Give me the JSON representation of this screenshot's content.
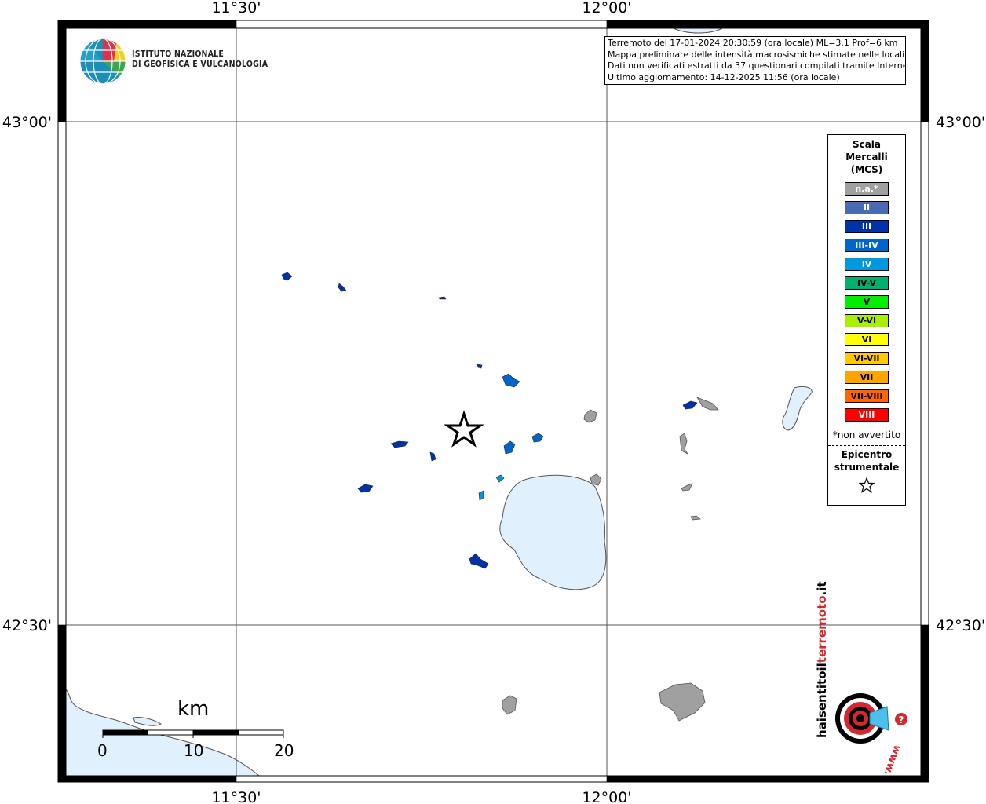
{
  "map": {
    "longitude_labels": [
      "11°30'",
      "12°00'"
    ],
    "latitude_labels": [
      "43°00'",
      "42°30'"
    ],
    "colors": {
      "water": "#e0f0fc",
      "na": "#a0a0a0",
      "III": "#0033aa",
      "III-IV": "#0066cc",
      "IV": "#0099dd"
    }
  },
  "header": {
    "logo_line1": "ISTITUTO NAZIONALE",
    "logo_line2": "DI GEOFISICA E VULCANOLOGIA"
  },
  "info": {
    "line1": "Terremoto del 17-01-2024 20:30:59 (ora locale) ML=3.1 Prof=6 km",
    "line2": "Mappa preliminare delle intensità macrosismiche stimate nelle località",
    "line3": "Dati non verificati estratti da 37 questionari compilati tramite Internet.",
    "line4": "Ultimo aggiornamento: 14-12-2025 11:56 (ora locale)"
  },
  "legend": {
    "title_line1": "Scala",
    "title_line2": "Mercalli",
    "title_line3": "(MCS)",
    "items": [
      {
        "label": "n.a.*",
        "color": "#a0a0a0",
        "text_color": "#ffffff"
      },
      {
        "label": "II",
        "color": "#4a6ab4",
        "text_color": "#ffffff"
      },
      {
        "label": "III",
        "color": "#0033aa",
        "text_color": "#ffffff"
      },
      {
        "label": "III-IV",
        "color": "#0066cc",
        "text_color": "#ffffff"
      },
      {
        "label": "IV",
        "color": "#0099dd",
        "text_color": "#ffffff"
      },
      {
        "label": "IV-V",
        "color": "#00b070",
        "text_color": "#000000"
      },
      {
        "label": "V",
        "color": "#00ee00",
        "text_color": "#000000"
      },
      {
        "label": "V-VI",
        "color": "#aaee00",
        "text_color": "#000000"
      },
      {
        "label": "VI",
        "color": "#ffff00",
        "text_color": "#000000"
      },
      {
        "label": "VI-VII",
        "color": "#ffc800",
        "text_color": "#000000"
      },
      {
        "label": "VII",
        "color": "#ffa500",
        "text_color": "#000000"
      },
      {
        "label": "VII-VIII",
        "color": "#ff6600",
        "text_color": "#000000"
      },
      {
        "label": "VIII",
        "color": "#ff0000",
        "text_color": "#ffffff"
      }
    ],
    "note": "*non avvertito",
    "epicenter_line1": "Epicentro",
    "epicenter_line2": "strumentale"
  },
  "scale_bar": {
    "unit": "km",
    "ticks": [
      "0",
      "10",
      "20"
    ]
  },
  "footer_logo": {
    "text_black": "haisentitoil",
    "text_red": "terremoto",
    "text_tld": ".it",
    "url": "www."
  }
}
